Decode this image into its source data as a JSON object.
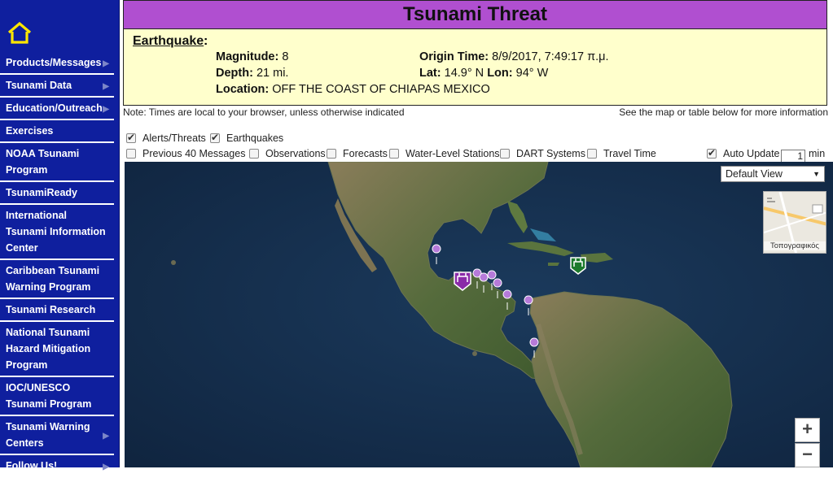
{
  "sidebar": {
    "items": [
      {
        "label": "Products/Messages",
        "chevron": true
      },
      {
        "label": "Tsunami Data",
        "chevron": true
      },
      {
        "label": "Education/Outreach",
        "chevron": true
      },
      {
        "label": "Exercises",
        "chevron": false
      },
      {
        "label": "NOAA Tsunami Program",
        "chevron": false
      },
      {
        "label": "TsunamiReady",
        "chevron": false
      },
      {
        "label": "International Tsunami Information Center",
        "chevron": false
      },
      {
        "label": "Caribbean Tsunami Warning Program",
        "chevron": false
      },
      {
        "label": "Tsunami Research",
        "chevron": false
      },
      {
        "label": "National Tsunami Hazard Mitigation Program",
        "chevron": false
      },
      {
        "label": "IOC/UNESCO Tsunami Program",
        "chevron": false
      },
      {
        "label": "Tsunami Warning Centers",
        "chevron": true
      },
      {
        "label": "Follow Us!",
        "chevron": true
      }
    ]
  },
  "banner": {
    "title": "Tsunami Threat",
    "earthquake_label": "Earthquake",
    "magnitude_label": "Magnitude:",
    "magnitude": "8",
    "depth_label": "Depth:",
    "depth": "21 mi.",
    "location_label": "Location:",
    "location": "OFF THE COAST OF CHIAPAS MEXICO",
    "origin_label": "Origin Time:",
    "origin": "8/9/2017, 7:49:17 π.μ.",
    "lat_label": "Lat:",
    "lat": "14.9° N",
    "lon_label": "Lon:",
    "lon": "94° W"
  },
  "notes": {
    "local_time": "Note: Times are local to your browser, unless otherwise indicated",
    "see_map": "See the map or table below for more information"
  },
  "layers": {
    "alerts": {
      "label": "Alerts/Threats",
      "checked": true
    },
    "earthquakes": {
      "label": "Earthquakes",
      "checked": true
    },
    "previous": {
      "label": "Previous 40 Messages",
      "checked": false
    },
    "observations": {
      "label": "Observations",
      "checked": false
    },
    "forecasts": {
      "label": "Forecasts",
      "checked": false
    },
    "water_level": {
      "label": "Water-Level Stations",
      "checked": false
    },
    "dart": {
      "label": "DART Systems",
      "checked": false
    },
    "travel_time": {
      "label": "Travel Time",
      "checked": false
    },
    "auto_update": {
      "label": "Auto Update",
      "checked": true,
      "value": "1",
      "unit": "min"
    }
  },
  "map": {
    "view_select": "Default View",
    "basemap_label": "Τοπογραφικός",
    "zoom_in": "+",
    "zoom_out": "−",
    "colors": {
      "ocean": "#16304e",
      "land": "#5f6a45",
      "marker": "#b67ad9",
      "threat_marker": "#8a2aa8",
      "station_marker": "#1d7a2c"
    }
  }
}
